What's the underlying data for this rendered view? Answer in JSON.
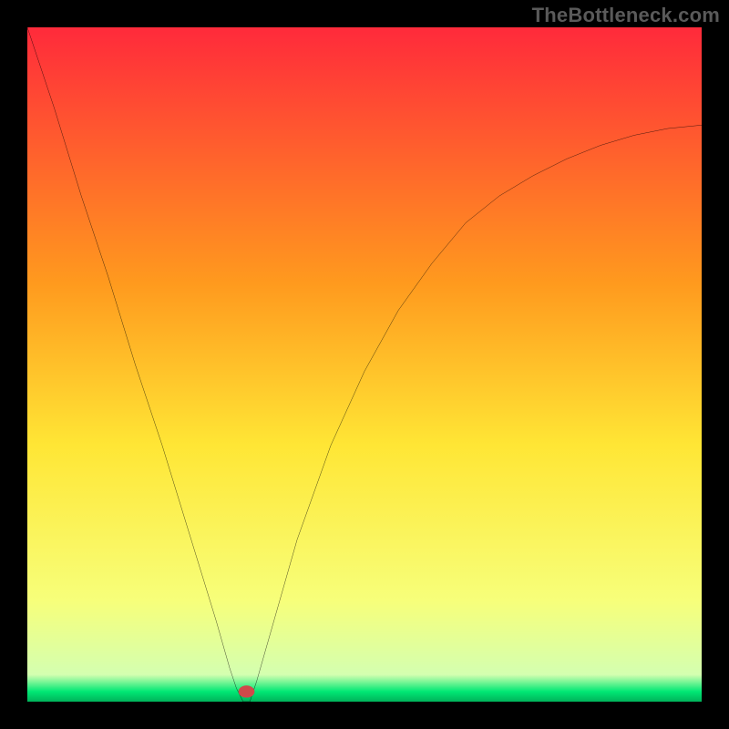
{
  "watermark": "TheBottleneck.com",
  "chart_data": {
    "type": "line",
    "title": "",
    "xlabel": "",
    "ylabel": "",
    "xlim": [
      0,
      100
    ],
    "ylim": [
      0,
      100
    ],
    "grid": false,
    "legend": false,
    "annotations": [],
    "background_gradient": {
      "top": "#ff2a3b",
      "mid_upper": "#ff9a1e",
      "mid": "#ffe635",
      "mid_lower": "#f7ff7a",
      "green_band": "#00e874",
      "bottom_line": "#00b35a"
    },
    "marker": {
      "x": 32.5,
      "y": 1.5,
      "color": "#cf4a4a",
      "rx": 1.2,
      "ry": 0.9
    },
    "series": [
      {
        "name": "curve",
        "color": "#000000",
        "x": [
          0,
          4,
          8,
          12,
          16,
          20,
          24,
          28,
          30,
          31,
          32,
          33,
          34,
          36,
          40,
          45,
          50,
          55,
          60,
          65,
          70,
          75,
          80,
          85,
          90,
          95,
          100
        ],
        "values": [
          100,
          88,
          75,
          63,
          50,
          38,
          25,
          12,
          5,
          2,
          0,
          0,
          3,
          10,
          24,
          38,
          49,
          58,
          65,
          71,
          75,
          78,
          80.5,
          82.5,
          84,
          85,
          85.5
        ]
      }
    ]
  }
}
